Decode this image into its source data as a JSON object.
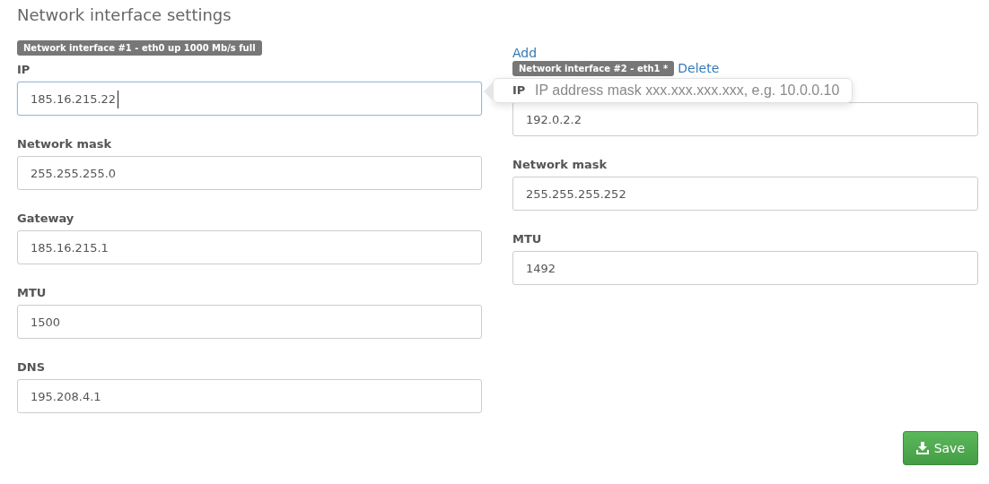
{
  "title": "Network interface settings",
  "interfaces": [
    {
      "badge": "Network interface #1 - eth0 up 1000 Mb/s full",
      "fields": [
        {
          "label": "IP",
          "value": "185.16.215.22",
          "focused": true
        },
        {
          "label": "Network mask",
          "value": "255.255.255.0",
          "focused": false
        },
        {
          "label": "Gateway",
          "value": "185.16.215.1",
          "focused": false
        },
        {
          "label": "MTU",
          "value": "1500",
          "focused": false
        },
        {
          "label": "DNS",
          "value": "195.208.4.1",
          "focused": false
        }
      ]
    },
    {
      "add_link": "Add",
      "badge": "Network interface #2 - eth1 *",
      "delete_link": "Delete",
      "fields": [
        {
          "label": "IP",
          "value": "192.0.2.2",
          "focused": false
        },
        {
          "label": "Network mask",
          "value": "255.255.255.252",
          "focused": false
        },
        {
          "label": "MTU",
          "value": "1492",
          "focused": false
        }
      ]
    }
  ],
  "tooltip": {
    "text": "IP address mask xxx.xxx.xxx.xxx, e.g. 10.0.0.10"
  },
  "save_button": {
    "label": "Save"
  }
}
